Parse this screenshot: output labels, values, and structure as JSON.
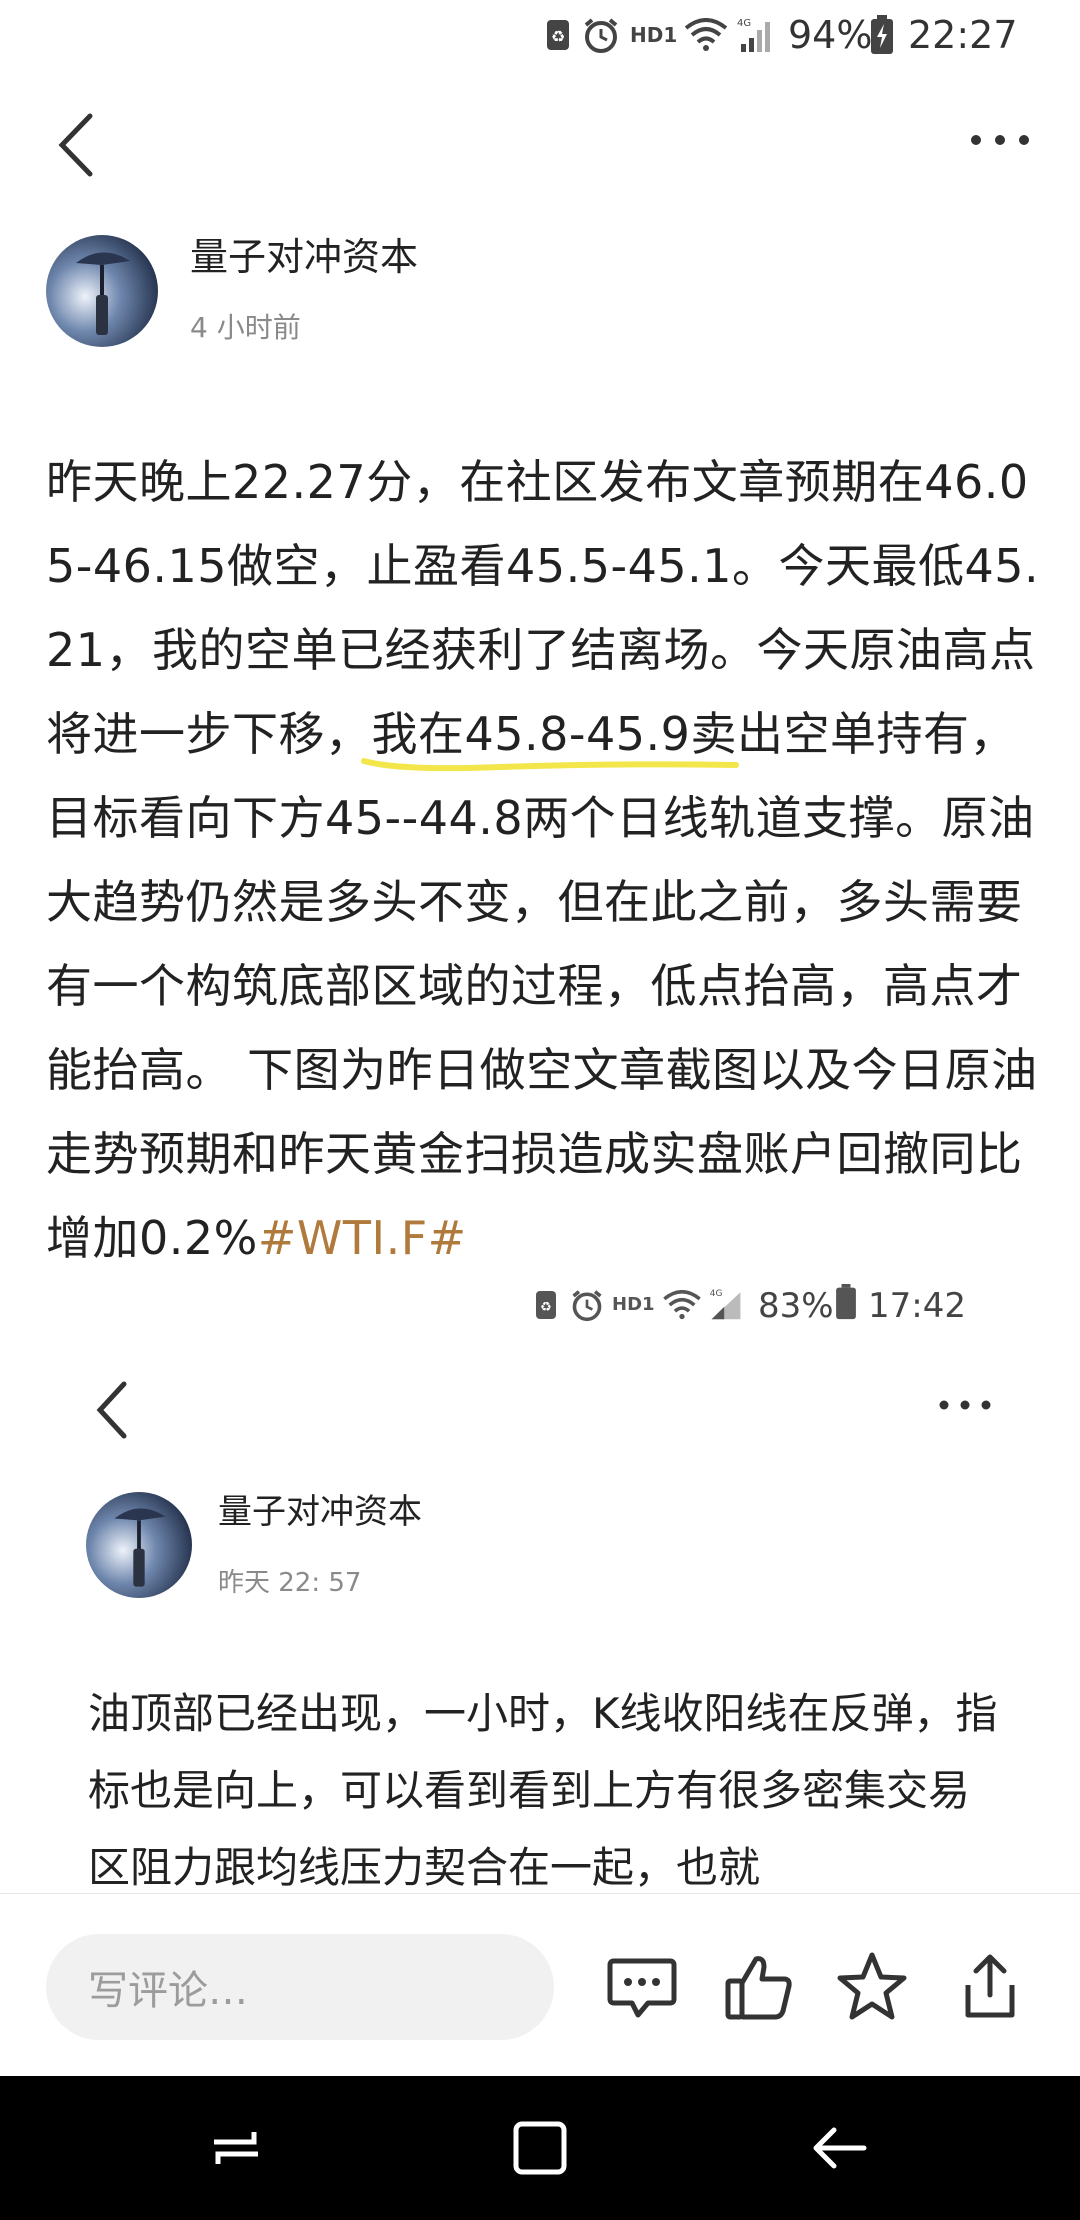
{
  "status_bar": {
    "hd_label": "HD1",
    "net_label": "4G",
    "battery": "94%",
    "time": "22:27"
  },
  "header": {
    "back_icon": "chevron-left-icon",
    "more_icon": "more-horizontal-icon"
  },
  "post": {
    "author": "量子对冲资本",
    "time": "4 小时前",
    "body_part1": "昨天晚上22.27分，在社区发布文章预期在46.05-46.15做空，止盈看45.5-45.1。今天最低45.21，我的空单已经获利了结离场。今天原油高点将进一步下移，",
    "body_highlight": "我在45.8-45.9卖",
    "body_part2": "出空单持有，目标看向下方45--44.8两个日线轨道支撑。原油大趋势仍然是多头不变，但在此之前，多头需要有一个构筑底部区域的过程，低点抬高，高点才能抬高。 下图为昨日做空文章截图以及今日原油走势预期和昨天黄金扫损造成实盘账户回撤同比增加0.2%",
    "hashtag": "#WTI.F#"
  },
  "embedded_screenshot": {
    "status_bar": {
      "hd_label": "HD1",
      "net_label": "4G",
      "battery": "83%",
      "time": "17:42"
    },
    "author": "量子对冲资本",
    "time": "昨天 22: 57",
    "body": "油顶部已经出现，一小时，K线收阳线在反弹，指标也是向上，可以看到看到上方有很多密集交易区阻力跟均线压力契合在一起，也就"
  },
  "action_bar": {
    "comment_placeholder": "写评论…",
    "icons": [
      "comment-icon",
      "like-icon",
      "favorite-star-icon",
      "share-icon"
    ]
  },
  "nav_bar": {
    "icons": [
      "recent-apps-icon",
      "home-icon",
      "back-icon"
    ]
  },
  "colors": {
    "hashtag": "#b07a3c",
    "highlight_underline": "#f3e64a",
    "nav_bg": "#000000"
  }
}
